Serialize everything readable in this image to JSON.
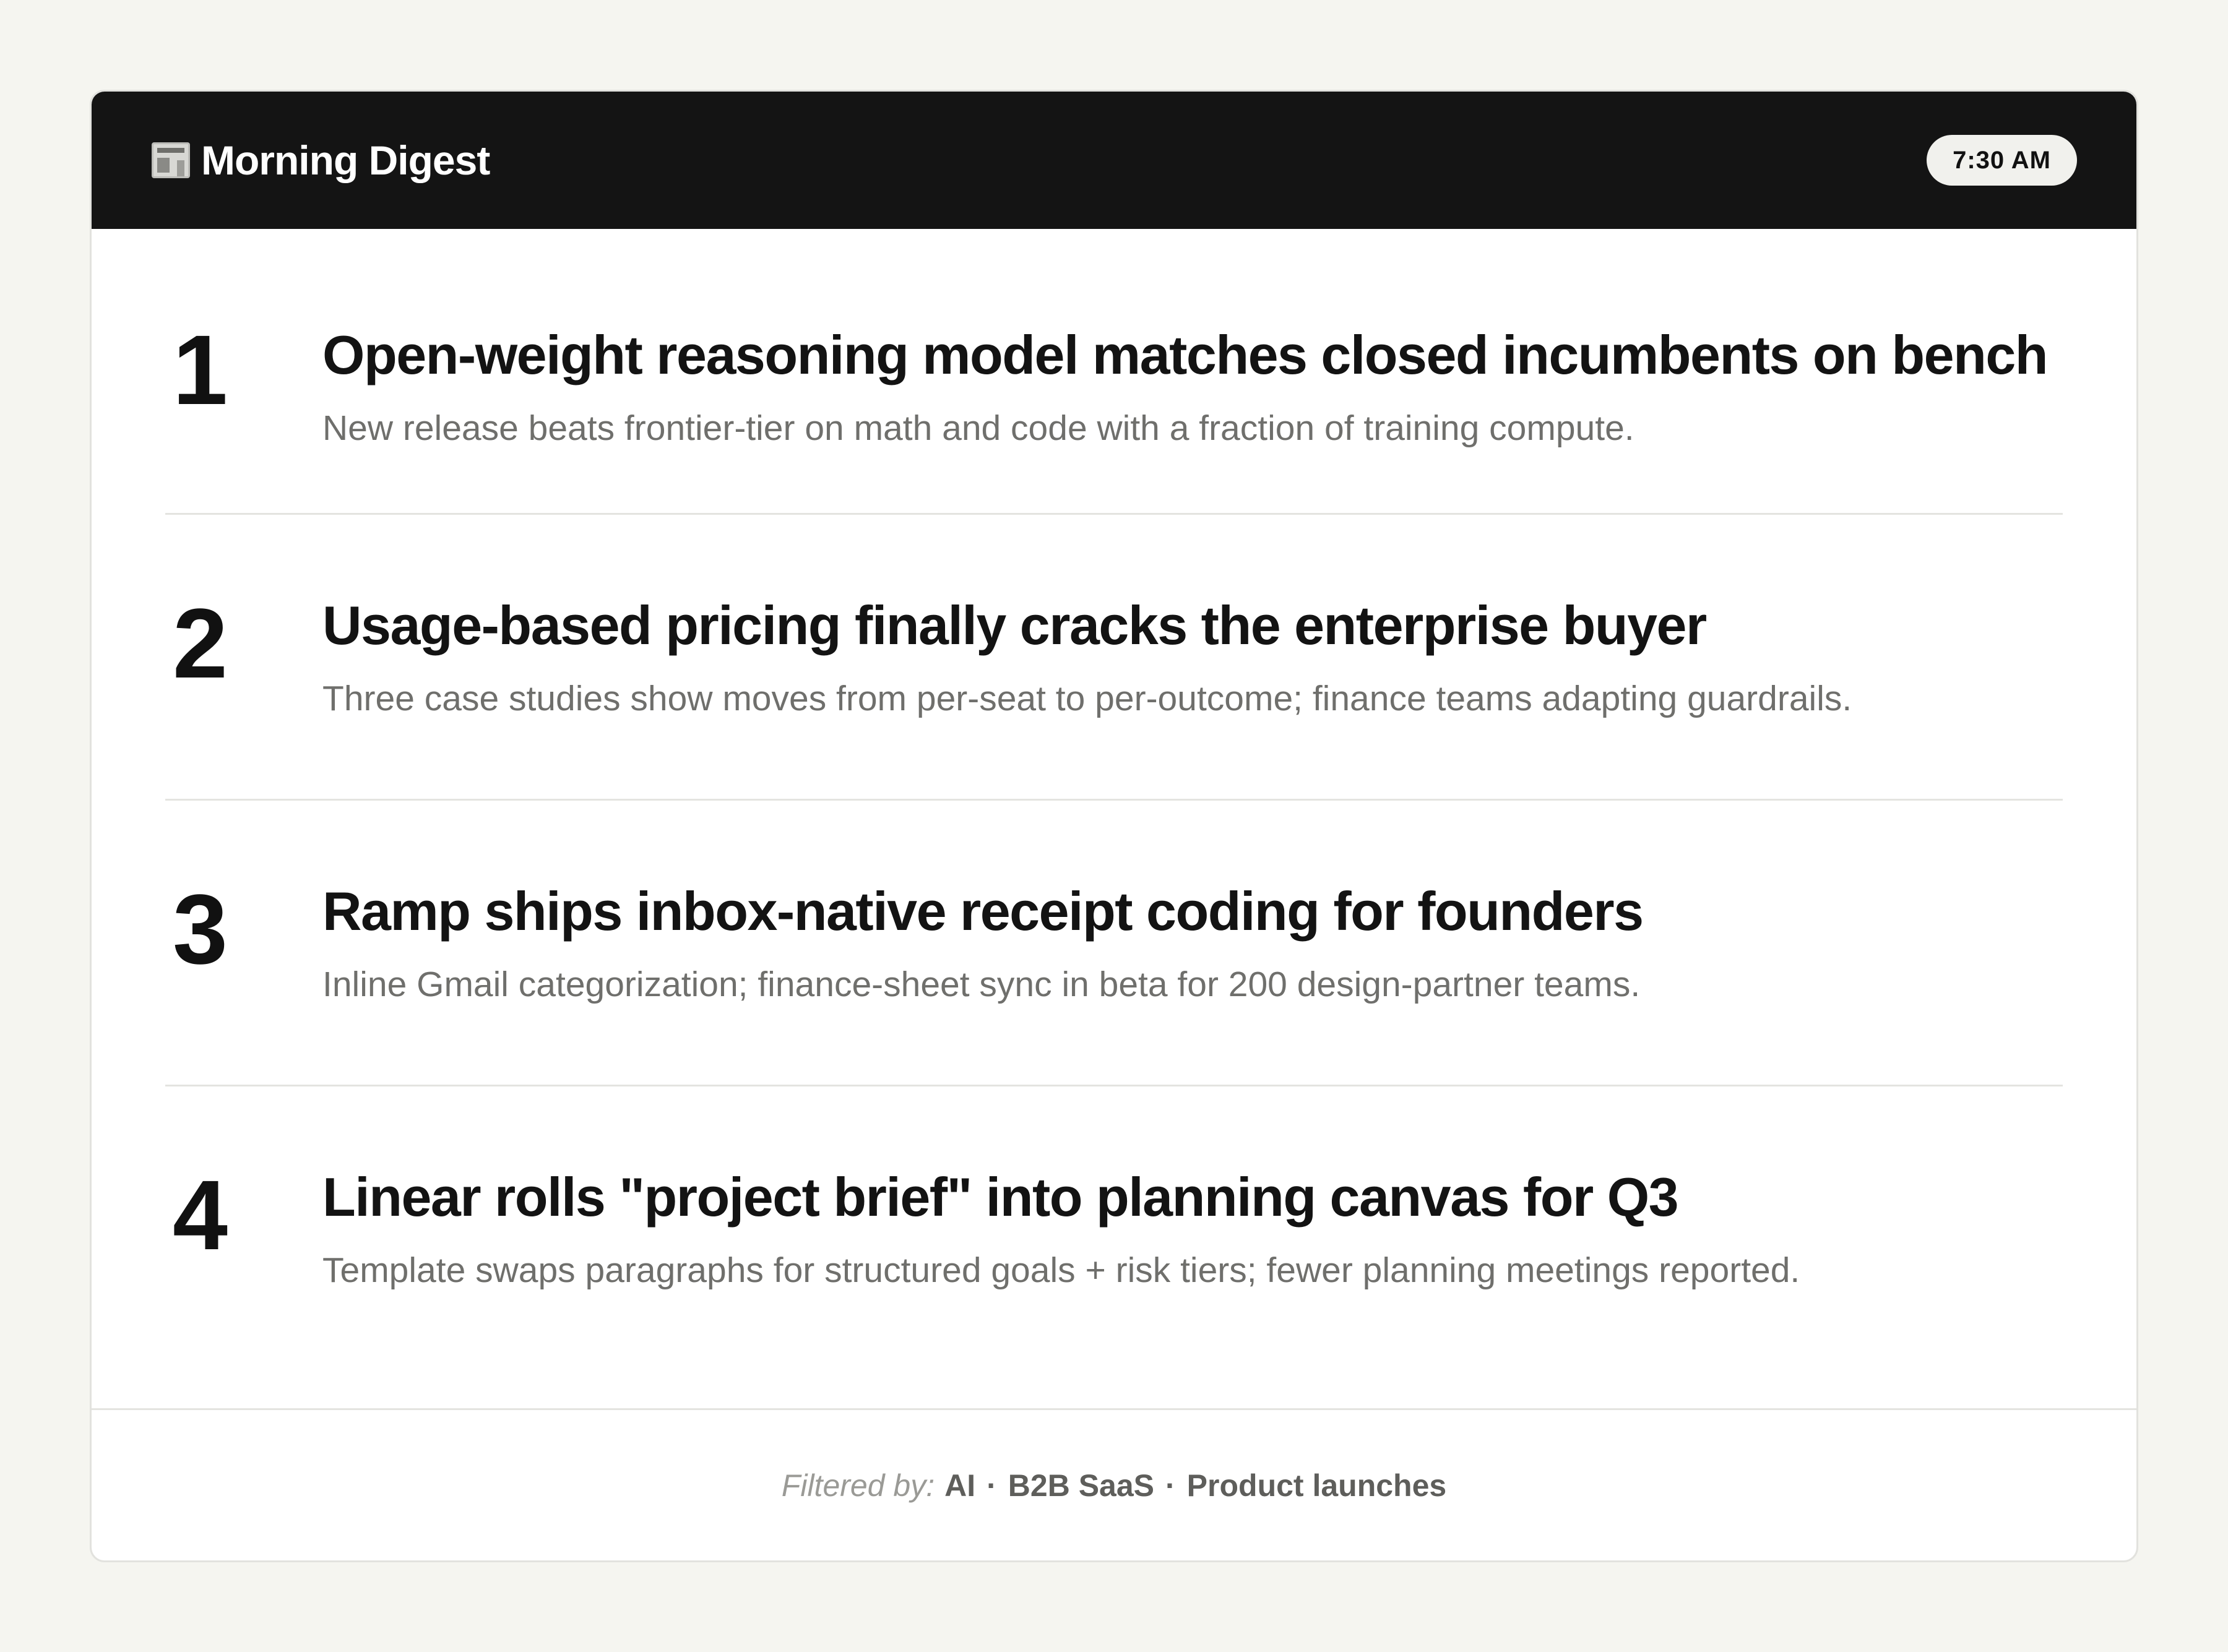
{
  "header": {
    "icon": "newspaper-icon",
    "title": "Morning Digest",
    "time": "7:30 AM"
  },
  "stories": [
    {
      "rank": "1",
      "title": "Open-weight reasoning model matches closed incumbents on bench",
      "summary": "New release beats frontier-tier on math and code with a fraction of training compute."
    },
    {
      "rank": "2",
      "title": "Usage-based pricing finally cracks the enterprise buyer",
      "summary": "Three case studies show moves from per-seat to per-outcome; finance teams adapting guardrails."
    },
    {
      "rank": "3",
      "title": "Ramp ships inbox-native receipt coding for founders",
      "summary": "Inline Gmail categorization; finance-sheet sync in beta for 200 design-partner teams."
    },
    {
      "rank": "4",
      "title": "Linear rolls \"project brief\" into planning canvas for Q3",
      "summary": "Template swaps paragraphs for structured goals + risk tiers; fewer planning meetings reported."
    }
  ],
  "footer": {
    "label": "Filtered by:",
    "filters": [
      "AI",
      "B2B SaaS",
      "Product launches"
    ],
    "separator": "·"
  },
  "colors": {
    "header_bg": "#141414",
    "page_bg": "#f5f5f0",
    "badge_bg": "#f1f1ed",
    "title_text": "#131313",
    "summary_text": "#6f6f6c"
  }
}
